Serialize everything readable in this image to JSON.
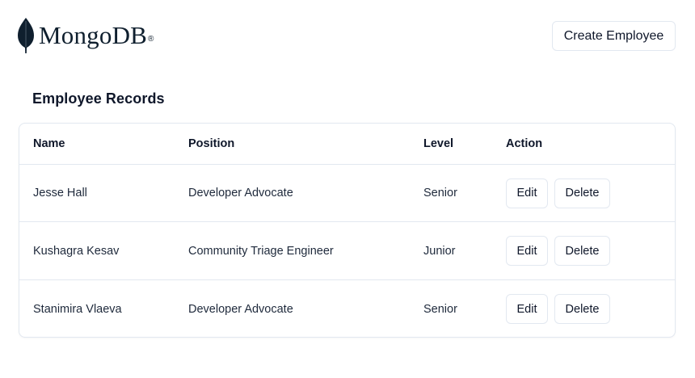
{
  "header": {
    "logo_text": "MongoDB",
    "logo_mark": "®",
    "create_label": "Create Employee"
  },
  "main": {
    "title": "Employee Records",
    "columns": [
      "Name",
      "Position",
      "Level",
      "Action"
    ],
    "rows": [
      {
        "name": "Jesse Hall",
        "position": "Developer Advocate",
        "level": "Senior",
        "edit": "Edit",
        "delete": "Delete"
      },
      {
        "name": "Kushagra Kesav",
        "position": "Community Triage Engineer",
        "level": "Junior",
        "edit": "Edit",
        "delete": "Delete"
      },
      {
        "name": "Stanimira Vlaeva",
        "position": "Developer Advocate",
        "level": "Senior",
        "edit": "Edit",
        "delete": "Delete"
      }
    ]
  },
  "colors": {
    "leaf": "#0f1f2e",
    "border": "#e2e8f0",
    "text": "#0f172a"
  }
}
